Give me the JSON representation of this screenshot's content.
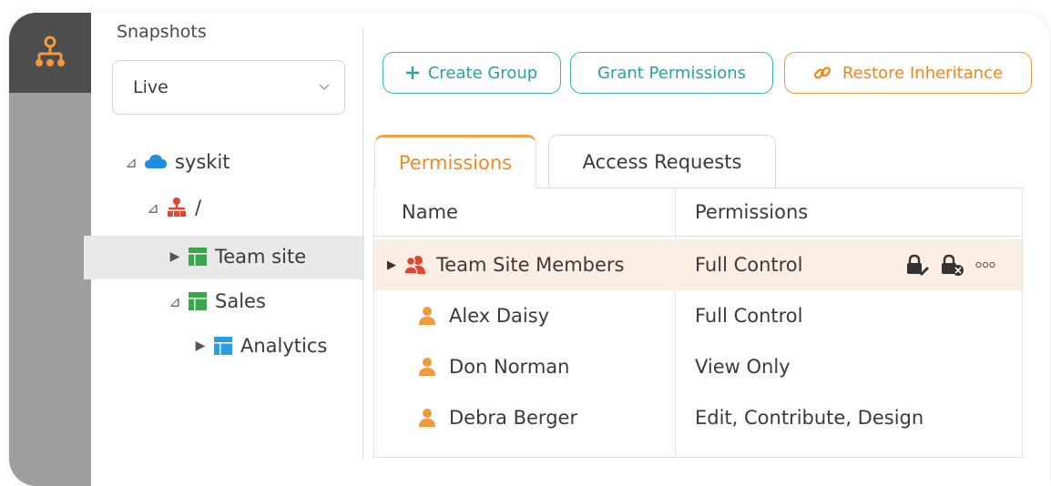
{
  "sidebar": {
    "snapshots_label": "Snapshots",
    "snapshot_select": {
      "value": "Live"
    },
    "tree": [
      {
        "label": "syskit",
        "icon": "cloud-icon"
      },
      {
        "label": "/",
        "icon": "hierarchy-icon"
      },
      {
        "label": "Team site",
        "icon": "site-icon",
        "selected": true
      },
      {
        "label": "Sales",
        "icon": "site-icon"
      },
      {
        "label": "Analytics",
        "icon": "subsite-icon"
      }
    ]
  },
  "toolbar": {
    "create_group": "Create Group",
    "grant_permissions": "Grant Permissions",
    "restore_inheritance": "Restore Inheritance"
  },
  "tabs": [
    {
      "label": "Permissions",
      "active": true
    },
    {
      "label": "Access Requests",
      "active": false
    }
  ],
  "table": {
    "columns": [
      "Name",
      "Permissions"
    ],
    "rows": [
      {
        "name": "Team Site Members",
        "permissions": "Full Control",
        "type": "group"
      },
      {
        "name": "Alex Daisy",
        "permissions": "Full Control",
        "type": "user"
      },
      {
        "name": "Don Norman",
        "permissions": "View Only",
        "type": "user"
      },
      {
        "name": "Debra Berger",
        "permissions": "Edit, Contribute, Design",
        "type": "user"
      }
    ]
  },
  "colors": {
    "teal": "#2aa0a2",
    "orange": "#f0861b",
    "rail_dark": "#4d4d4d",
    "rail": "#9e9e9e",
    "row_highlight": "#fbeee4",
    "green_site": "#3aa74a",
    "blue_site": "#2a9de0",
    "red_group": "#e0452e"
  }
}
